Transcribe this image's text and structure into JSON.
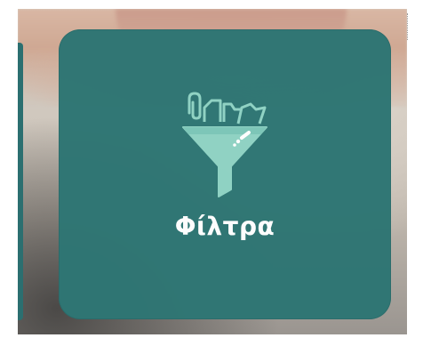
{
  "card": {
    "label": "Φίλτρα",
    "icon": "filter-funnel-with-files-icon",
    "background_color": "#2f7674",
    "icon_color": "#8fd3c4",
    "label_color": "#ffffff"
  }
}
